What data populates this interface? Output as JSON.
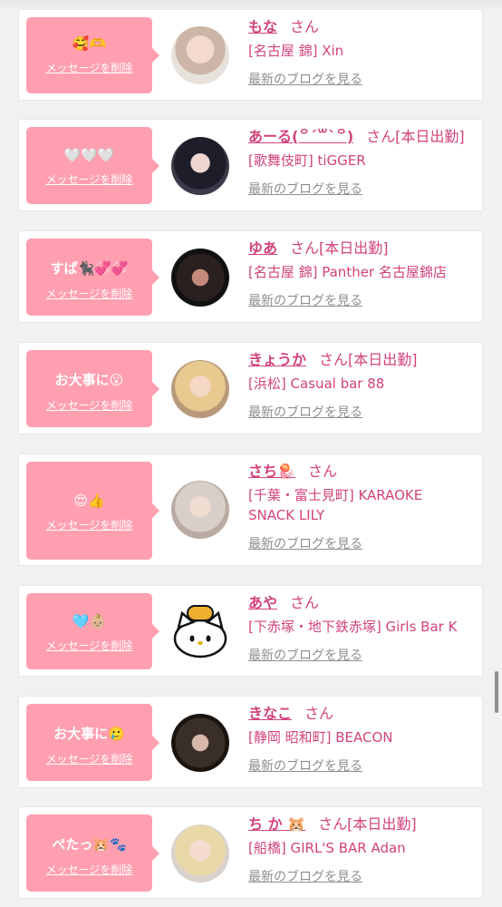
{
  "delete_label": "メッセージを削除",
  "san_label": "さん",
  "blog_label": "最新のブログを見る",
  "colors": {
    "bubble": "#ff9fb0",
    "name": "#d2437b",
    "link": "#8e8e8e"
  },
  "entries": [
    {
      "message": "🥰🫶",
      "name": "もな",
      "status": "",
      "shop": "[名古屋 錦] Xin"
    },
    {
      "message": "🤍🤍🤍",
      "name": "あーる(꒪ˊ꒳ˋ꒪)",
      "status": "[本日出勤]",
      "shop": "[歌舞伎町] tiGGER"
    },
    {
      "message": "すぱ🐈‍⬛💞💞",
      "name": "ゆあ",
      "status": "[本日出勤]",
      "shop": "[名古屋 錦] Panther 名古屋錦店"
    },
    {
      "message": "お大事に😮",
      "name": "きょうか",
      "status": "[本日出勤]",
      "shop": "[浜松] Casual bar 88"
    },
    {
      "message": "😍👍",
      "name": "さち🪼",
      "status": "",
      "shop": "[千葉・富士見町] KARAOKE SNACK LILY"
    },
    {
      "message": "🩵👶🏼",
      "name": "あや",
      "status": "",
      "shop": "[下赤塚・地下鉄赤塚] Girls Bar K"
    },
    {
      "message": "お大事に🥲",
      "name": "きなこ",
      "status": "",
      "shop": "[静岡 昭和町] BEACON"
    },
    {
      "message": "ぺたっ🐹🐾",
      "name": "ち か 🐹",
      "status": "[本日出勤]",
      "shop": "[船橋] GIRL'S BAR Adan"
    }
  ]
}
